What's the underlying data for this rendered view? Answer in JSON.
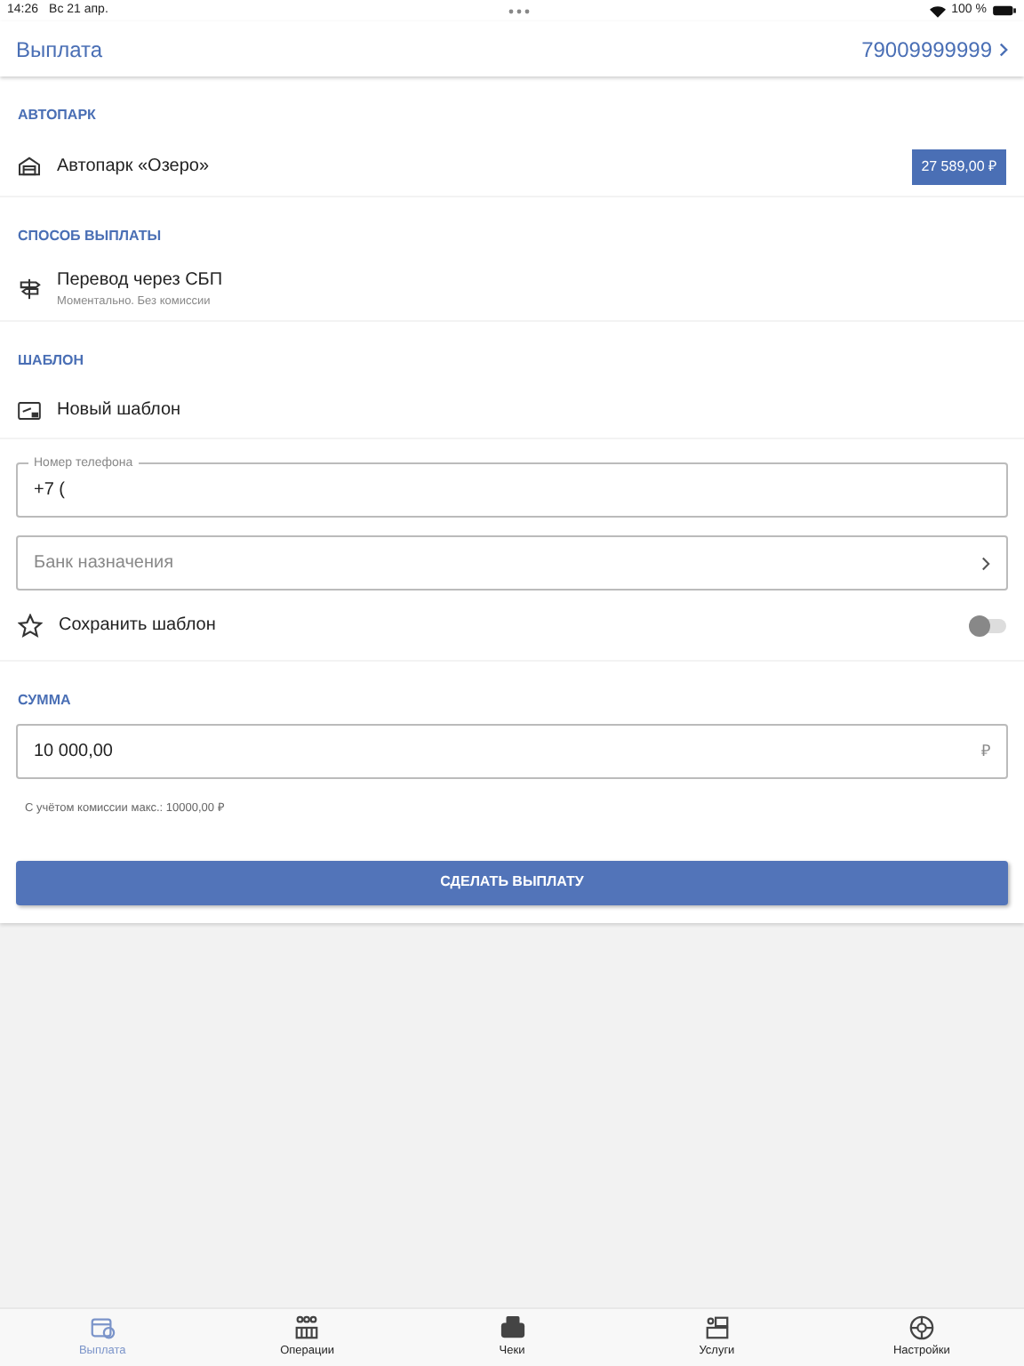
{
  "status_bar": {
    "time": "14:26",
    "date": "Вс 21 апр.",
    "battery": "100 %"
  },
  "nav": {
    "title": "Выплата",
    "account": "79009999999"
  },
  "fleet": {
    "header": "АВТОПАРК",
    "name": "Автопарк «Озеро»",
    "balance": "27 589,00 ₽"
  },
  "method": {
    "header": "СПОСОБ ВЫПЛАТЫ",
    "name": "Перевод через СБП",
    "note": "Моментально. Без комиссии"
  },
  "template": {
    "header": "ШАБЛОН",
    "name": "Новый шаблон"
  },
  "phone_field": {
    "label": "Номер телефона",
    "value": "+7 ("
  },
  "bank_field": {
    "placeholder": "Банк назначения"
  },
  "save_template": {
    "label": "Сохранить шаблон",
    "on": false
  },
  "amount": {
    "header": "СУММА",
    "value": "10 000,00",
    "currency": "₽",
    "hint": "С учётом комиссии макс.: 10000,00 ₽"
  },
  "submit": "СДЕЛАТЬ ВЫПЛАТУ",
  "tabs": [
    {
      "label": "Выплата",
      "selected": true
    },
    {
      "label": "Операции",
      "selected": false
    },
    {
      "label": "Чеки",
      "selected": false
    },
    {
      "label": "Услуги",
      "selected": false
    },
    {
      "label": "Настройки",
      "selected": false
    }
  ]
}
